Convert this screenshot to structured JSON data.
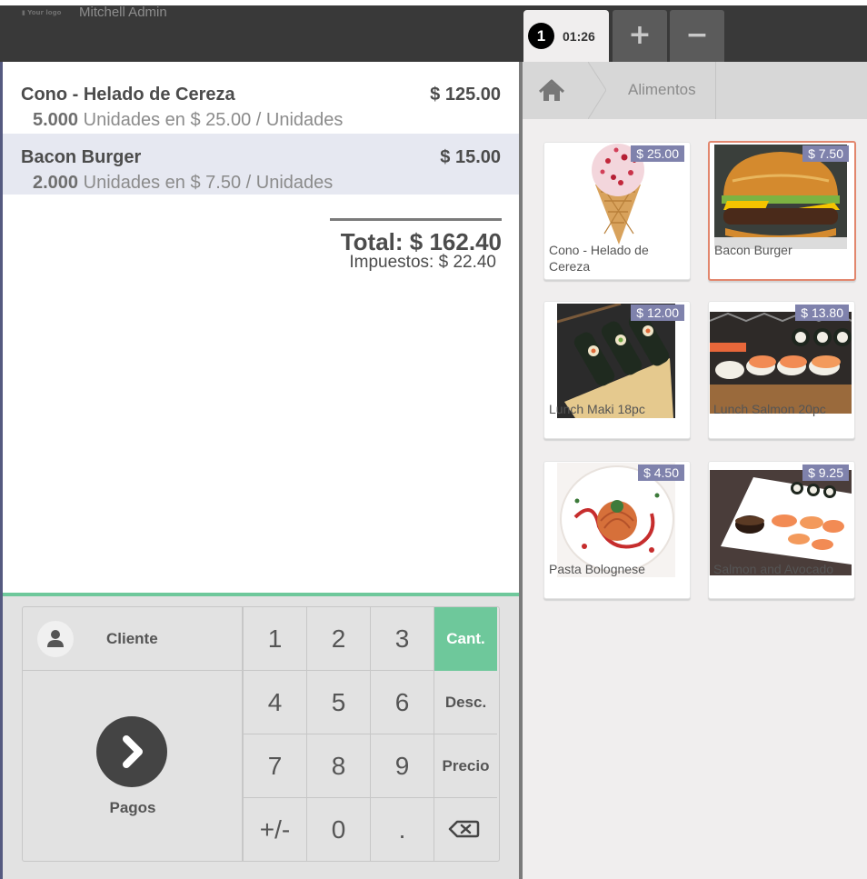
{
  "header": {
    "logo_text": "Your logo",
    "user_name": "Mitchell Admin",
    "order_tab": {
      "sequence": "1",
      "time": "01:26"
    },
    "add_order_label": "+",
    "remove_order_label": "−"
  },
  "order": {
    "lines": [
      {
        "product": "Cono - Helado de Cereza",
        "price": "$ 125.00",
        "qty": "5.000",
        "detail": "Unidades en $ 25.00 / Unidades",
        "selected": false
      },
      {
        "product": "Bacon Burger",
        "price": "$ 15.00",
        "qty": "2.000",
        "detail": "Unidades en $ 7.50 / Unidades",
        "selected": true
      }
    ],
    "total_label": "Total:",
    "total_value": "$ 162.40",
    "tax_label": "Impuestos:",
    "tax_value": "$ 22.40"
  },
  "actionpad": {
    "customer_label": "Cliente",
    "payment_label": "Pagos"
  },
  "numpad": {
    "keys": [
      "1",
      "2",
      "3",
      "4",
      "5",
      "6",
      "7",
      "8",
      "9",
      "+/-",
      "0",
      "."
    ],
    "modes": {
      "qty": "Cant.",
      "disc": "Desc.",
      "price": "Precio"
    },
    "active_mode": "qty"
  },
  "category": {
    "home_icon": "home-icon",
    "current": "Alimentos"
  },
  "products": [
    {
      "name": "Cono - Helado de Cereza",
      "price": "$ 25.00",
      "selected": false
    },
    {
      "name": "Bacon Burger",
      "price": "$ 7.50",
      "selected": true
    },
    {
      "name": "Lunch Maki 18pc",
      "price": "$ 12.00",
      "selected": false
    },
    {
      "name": "Lunch Salmon 20pc",
      "price": "$ 13.80",
      "selected": false
    },
    {
      "name": "Pasta Bolognese",
      "price": "$ 4.50",
      "selected": false
    },
    {
      "name": "Salmon and Avocado",
      "price": "$ 9.25",
      "selected": false
    }
  ],
  "colors": {
    "header_bg": "#393939",
    "accent_green": "#6ec89b",
    "price_tag": "#7f82ac",
    "selected_card_border": "#e2876e",
    "selected_line_bg": "#e6e8f1"
  }
}
